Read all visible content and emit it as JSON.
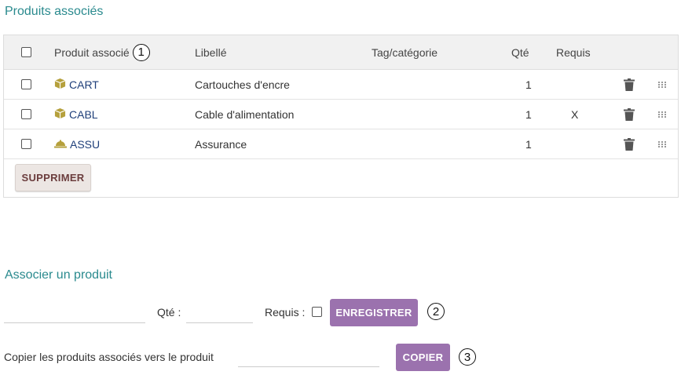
{
  "section_produits": {
    "title": "Produits associés"
  },
  "table": {
    "columns": {
      "produit": "Produit associé",
      "libelle": "Libellé",
      "tag": "Tag/catégorie",
      "qte": "Qté",
      "requis": "Requis"
    },
    "header_annotation": "1",
    "rows": [
      {
        "icon": "box-icon",
        "code": "CART",
        "libelle": "Cartouches d'encre",
        "tag": "",
        "qte": "1",
        "requis": ""
      },
      {
        "icon": "box-icon",
        "code": "CABL",
        "libelle": "Cable d'alimentation",
        "tag": "",
        "qte": "1",
        "requis": "X"
      },
      {
        "icon": "service-bell-icon",
        "code": "ASSU",
        "libelle": "Assurance",
        "tag": "",
        "qte": "1",
        "requis": ""
      }
    ],
    "delete_button": "SUPPRIMER"
  },
  "section_associer": {
    "title": "Associer un produit",
    "product_input_value": "",
    "qte_label": "Qté :",
    "qte_input_value": "",
    "requis_label": "Requis :",
    "save_button": "ENREGISTRER",
    "save_annotation": "2"
  },
  "copy_section": {
    "label": "Copier les produits associés vers le produit",
    "input_value": "",
    "button": "COPIER",
    "annotation": "3"
  },
  "colors": {
    "section_title": "#2a8a8e",
    "link": "#1f3f7a",
    "icon_gold": "#b5a03c",
    "button_purple": "#9b72ae",
    "button_delete_text": "#6b3d3d"
  }
}
